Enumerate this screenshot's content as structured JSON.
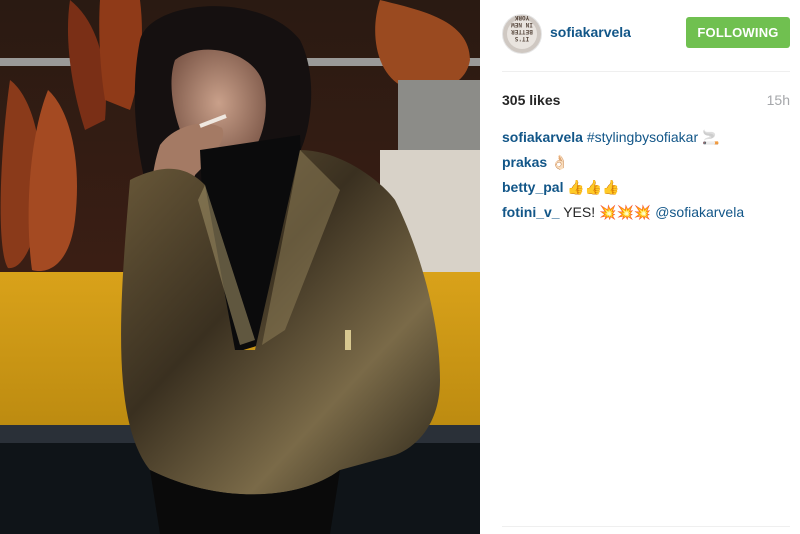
{
  "post": {
    "username": "sofiakarvela",
    "follow_label": "FOLLOWING",
    "likes": "305 likes",
    "time": "15h",
    "avatar_text": "IT'S BETTER IN NEW YORK"
  },
  "comments": [
    {
      "user": "sofiakarvela",
      "tag": "#stylingbysofiakar",
      "text": "🚬"
    },
    {
      "user": "prakas",
      "text": "👌🏻"
    },
    {
      "user": "betty_pal",
      "text": "👍👍👍"
    },
    {
      "user": "fotini_v_",
      "text": "YES! 💥💥💥",
      "mention": "@sofiakarvela"
    }
  ],
  "colors": {
    "link": "#125688",
    "follow_button": "#70c050",
    "time": "#a5a7aa"
  }
}
